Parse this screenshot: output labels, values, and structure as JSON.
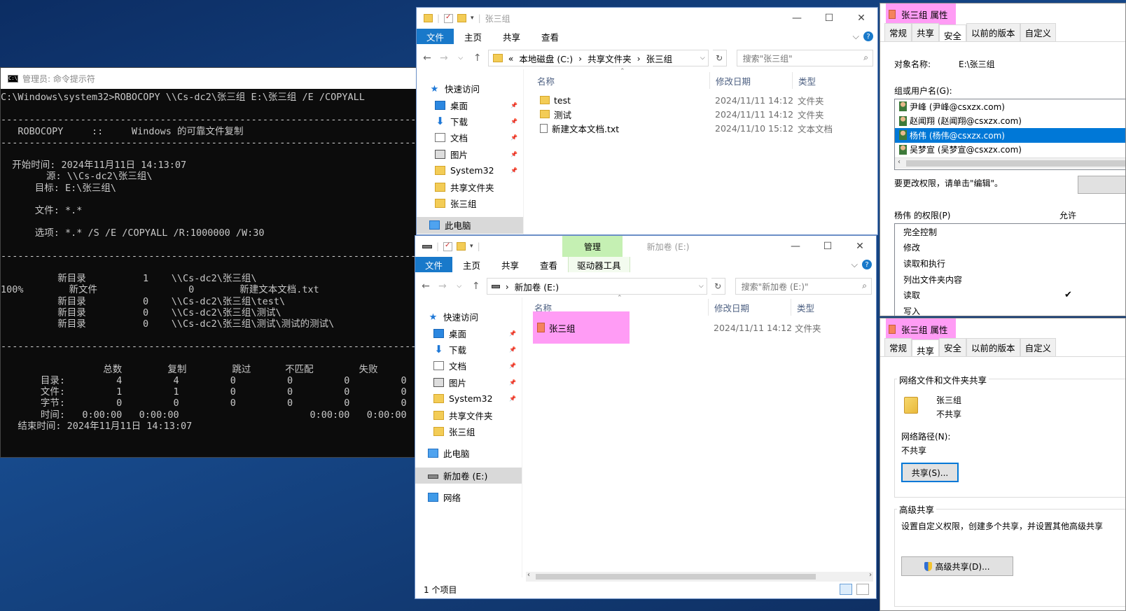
{
  "cmd": {
    "title": "管理员: 命令提示符",
    "icon": "cmd-icon",
    "lines": [
      "C:\\Windows\\system32>ROBOCOPY \\\\Cs-dc2\\张三组 E:\\张三组 /E /COPYALL",
      "",
      "-------------------------------------------------------------------------------",
      "   ROBOCOPY     ::     Windows 的可靠文件复制",
      "-------------------------------------------------------------------------------",
      "",
      "  开始时间: 2024年11月11日 14:13:07",
      "        源: \\\\Cs-dc2\\张三组\\",
      "      目标: E:\\张三组\\",
      "",
      "      文件: *.*",
      "",
      "      选项: *.* /S /E /COPYALL /R:1000000 /W:30",
      "",
      "-------------------------------------------------------------------------------",
      "",
      "          新目录          1    \\\\Cs-dc2\\张三组\\",
      "100%        新文件                0        新建文本文档.txt",
      "          新目录          0    \\\\Cs-dc2\\张三组\\test\\",
      "          新目录          0    \\\\Cs-dc2\\张三组\\测试\\",
      "          新目录          0    \\\\Cs-dc2\\张三组\\测试\\测试的测试\\",
      "",
      "-------------------------------------------------------------------------------",
      "",
      "                  总数        复制        跳过      不匹配        失败",
      "       目录:         4         4         0         0         0         0",
      "       文件:         1         1         0         0         0         0",
      "       字节:         0         0         0         0         0         0",
      "       时间:   0:00:00   0:00:00                       0:00:00   0:00:00",
      "   结束时间: 2024年11月11日 14:13:07"
    ]
  },
  "explorer1": {
    "title": "张三组",
    "ribbon": [
      "文件",
      "主页",
      "共享",
      "查看"
    ],
    "address": [
      "«",
      "本地磁盘 (C:)",
      "›",
      "共享文件夹",
      "›",
      "张三组"
    ],
    "search_placeholder": "搜索\"张三组\"",
    "columns": [
      "名称",
      "修改日期",
      "类型"
    ],
    "nav": [
      {
        "label": "快速访问",
        "icon": "star-icon"
      },
      {
        "label": "桌面",
        "icon": "desktop-icon"
      },
      {
        "label": "下载",
        "icon": "download-icon"
      },
      {
        "label": "文档",
        "icon": "document-icon"
      },
      {
        "label": "图片",
        "icon": "picture-icon"
      },
      {
        "label": "System32",
        "icon": "folder-icon"
      },
      {
        "label": "共享文件夹",
        "icon": "folder-icon"
      },
      {
        "label": "张三组",
        "icon": "folder-icon"
      },
      {
        "label": "此电脑",
        "icon": "pc-icon"
      }
    ],
    "files": [
      {
        "name": "test",
        "date": "2024/11/11 14:12",
        "type": "文件夹"
      },
      {
        "name": "测试",
        "date": "2024/11/11 14:12",
        "type": "文件夹"
      },
      {
        "name": "新建文本文档.txt",
        "date": "2024/11/10 15:12",
        "type": "文本文档"
      }
    ]
  },
  "explorer2": {
    "title": "新加卷 (E:)",
    "context_tab": "管理",
    "ribbon": [
      "文件",
      "主页",
      "共享",
      "查看",
      "驱动器工具"
    ],
    "address": [
      "›",
      "新加卷 (E:)"
    ],
    "search_placeholder": "搜索\"新加卷 (E:)\"",
    "columns": [
      "名称",
      "修改日期",
      "类型"
    ],
    "nav": [
      {
        "label": "快速访问",
        "icon": "star-icon"
      },
      {
        "label": "桌面",
        "icon": "desktop-icon"
      },
      {
        "label": "下载",
        "icon": "download-icon"
      },
      {
        "label": "文档",
        "icon": "document-icon"
      },
      {
        "label": "图片",
        "icon": "picture-icon"
      },
      {
        "label": "System32",
        "icon": "folder-icon"
      },
      {
        "label": "共享文件夹",
        "icon": "folder-icon"
      },
      {
        "label": "张三组",
        "icon": "folder-icon"
      },
      {
        "label": "此电脑",
        "icon": "pc-icon"
      },
      {
        "label": "新加卷 (E:)",
        "icon": "drive-icon"
      },
      {
        "label": "网络",
        "icon": "network-icon"
      }
    ],
    "files": [
      {
        "name": "张三组",
        "date": "2024/11/11 14:12",
        "type": "文件夹"
      }
    ],
    "status": "1 个项目",
    "highlight_color": "#ff9cf5"
  },
  "props_security": {
    "title": "张三组 属性",
    "tabs": [
      "常规",
      "共享",
      "安全",
      "以前的版本",
      "自定义"
    ],
    "active_tab": "安全",
    "object_label": "对象名称:",
    "object_value": "E:\\张三组",
    "group_label": "组或用户名(G):",
    "users": [
      "尹峰 (尹峰@csxzx.com)",
      "赵闻翔 (赵闻翔@csxzx.com)",
      "杨伟 (杨伟@csxzx.com)",
      "吴梦宣 (吴梦宣@csxzx.com)"
    ],
    "selected_user": 2,
    "change_hint": "要更改权限，请单击\"编辑\"。",
    "perm_label": "杨伟 的权限(P)",
    "allow_label": "允许",
    "permissions": [
      {
        "name": "完全控制",
        "allow": ""
      },
      {
        "name": "修改",
        "allow": ""
      },
      {
        "name": "读取和执行",
        "allow": ""
      },
      {
        "name": "列出文件夹内容",
        "allow": ""
      },
      {
        "name": "读取",
        "allow": "✔"
      },
      {
        "name": "写入",
        "allow": ""
      }
    ]
  },
  "props_share": {
    "title": "张三组 属性",
    "tabs": [
      "常规",
      "共享",
      "安全",
      "以前的版本",
      "自定义"
    ],
    "active_tab": "共享",
    "group1_title": "网络文件和文件夹共享",
    "folder_name": "张三组",
    "share_state": "不共享",
    "path_label": "网络路径(N):",
    "path_value": "不共享",
    "share_button": "共享(S)...",
    "group2_title": "高级共享",
    "adv_desc": "设置自定义权限，创建多个共享，并设置其他高级共享",
    "adv_button": "高级共享(D)..."
  }
}
